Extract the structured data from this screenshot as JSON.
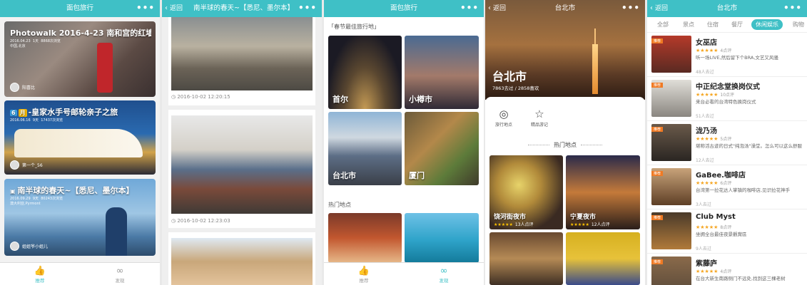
{
  "screen1": {
    "title": "面包旅行",
    "menu": "•••",
    "cards": [
      {
        "title": "Photowalk 2016-4-23 南和宫的红墙",
        "date": "2016.04.23",
        "days": "1天",
        "views": "8868次浏览",
        "location": "中国,北京",
        "author": "阳喜比"
      },
      {
        "badge1": "6",
        "badge2": "月",
        "title": "-皇家水手号邮轮亲子之旅",
        "date": "2016.06.16",
        "days": "9天",
        "views": "17437次浏览",
        "location": "",
        "author": "第一个_56"
      },
      {
        "title": "南半球的春天~【悉尼、墨尔本】",
        "date": "2016.09.29",
        "days": "9天",
        "views": "80243次浏览",
        "location": "澳大利亚,Pyrmont",
        "author": "姐姐爷小姐儿"
      }
    ],
    "tabs": {
      "recommend": "推荐",
      "discover": "发现"
    }
  },
  "screen2": {
    "back": "返回",
    "title": "南半球的春天~【悉尼、墨尔本】",
    "menu": "•••",
    "times": [
      "2016-10-02 12:20:15",
      "2016-10-02 12:23:03"
    ]
  },
  "screen3": {
    "title": "面包旅行",
    "menu": "•••",
    "section1": "「春节最佳旅行地」",
    "cities": [
      "首尔",
      "小樽市",
      "台北市",
      "厦门"
    ],
    "section2": "热门地点",
    "tabs": {
      "recommend": "推荐",
      "discover": "发现"
    }
  },
  "screen4": {
    "back": "返回",
    "title": "台北市",
    "menu": "•••",
    "city": "台北市",
    "stats": "7863去过 / 2858喜欢",
    "actions": [
      "旅行地点",
      "精品游记"
    ],
    "hot_title": "热门地点",
    "spots": [
      {
        "name": "饶河街夜市",
        "count": "13人点评"
      },
      {
        "name": "宁夏夜市",
        "count": "12人点评"
      }
    ]
  },
  "screen5": {
    "back": "返回",
    "title": "台北市",
    "menu": "•••",
    "categories": [
      "全部",
      "景点",
      "住宿",
      "餐厅",
      "休闲娱乐",
      "购物"
    ],
    "tag": "推荐",
    "places": [
      {
        "name": "女巫店",
        "reviews": "4点评",
        "desc": "听一场LIVE,然后留下个BRA,文艺又风骚",
        "count": "48人去过"
      },
      {
        "name": "中正纪念堂换岗仪式",
        "reviews": "10点评",
        "desc": "来台必看的台湾特色换岗仪式",
        "count": "51人去过"
      },
      {
        "name": "泷乃汤",
        "reviews": "5点评",
        "desc": "堪称活古迹的日式\"纯泡汤\"澡堂。怎么可以这么舒服",
        "count": "12人去过"
      },
      {
        "name": "GaBee.咖啡店",
        "reviews": "6点评",
        "desc": "台湾第一拉花达人掌镇的咖啡店,见识拉花神手",
        "count": "3人去过"
      },
      {
        "name": "Club Myst",
        "reviews": "8点评",
        "desc": "坐拥全台最佳夜景觀賞區",
        "count": "9人去过"
      },
      {
        "name": "紫藤庐",
        "reviews": "4点评",
        "desc": "在台大新生南路侧门不远处,找到这三棵老树",
        "count": ""
      }
    ]
  },
  "colors": {
    "brand": "#3fc0c6",
    "tag": "#f07a24",
    "stars": "#f5a623"
  }
}
